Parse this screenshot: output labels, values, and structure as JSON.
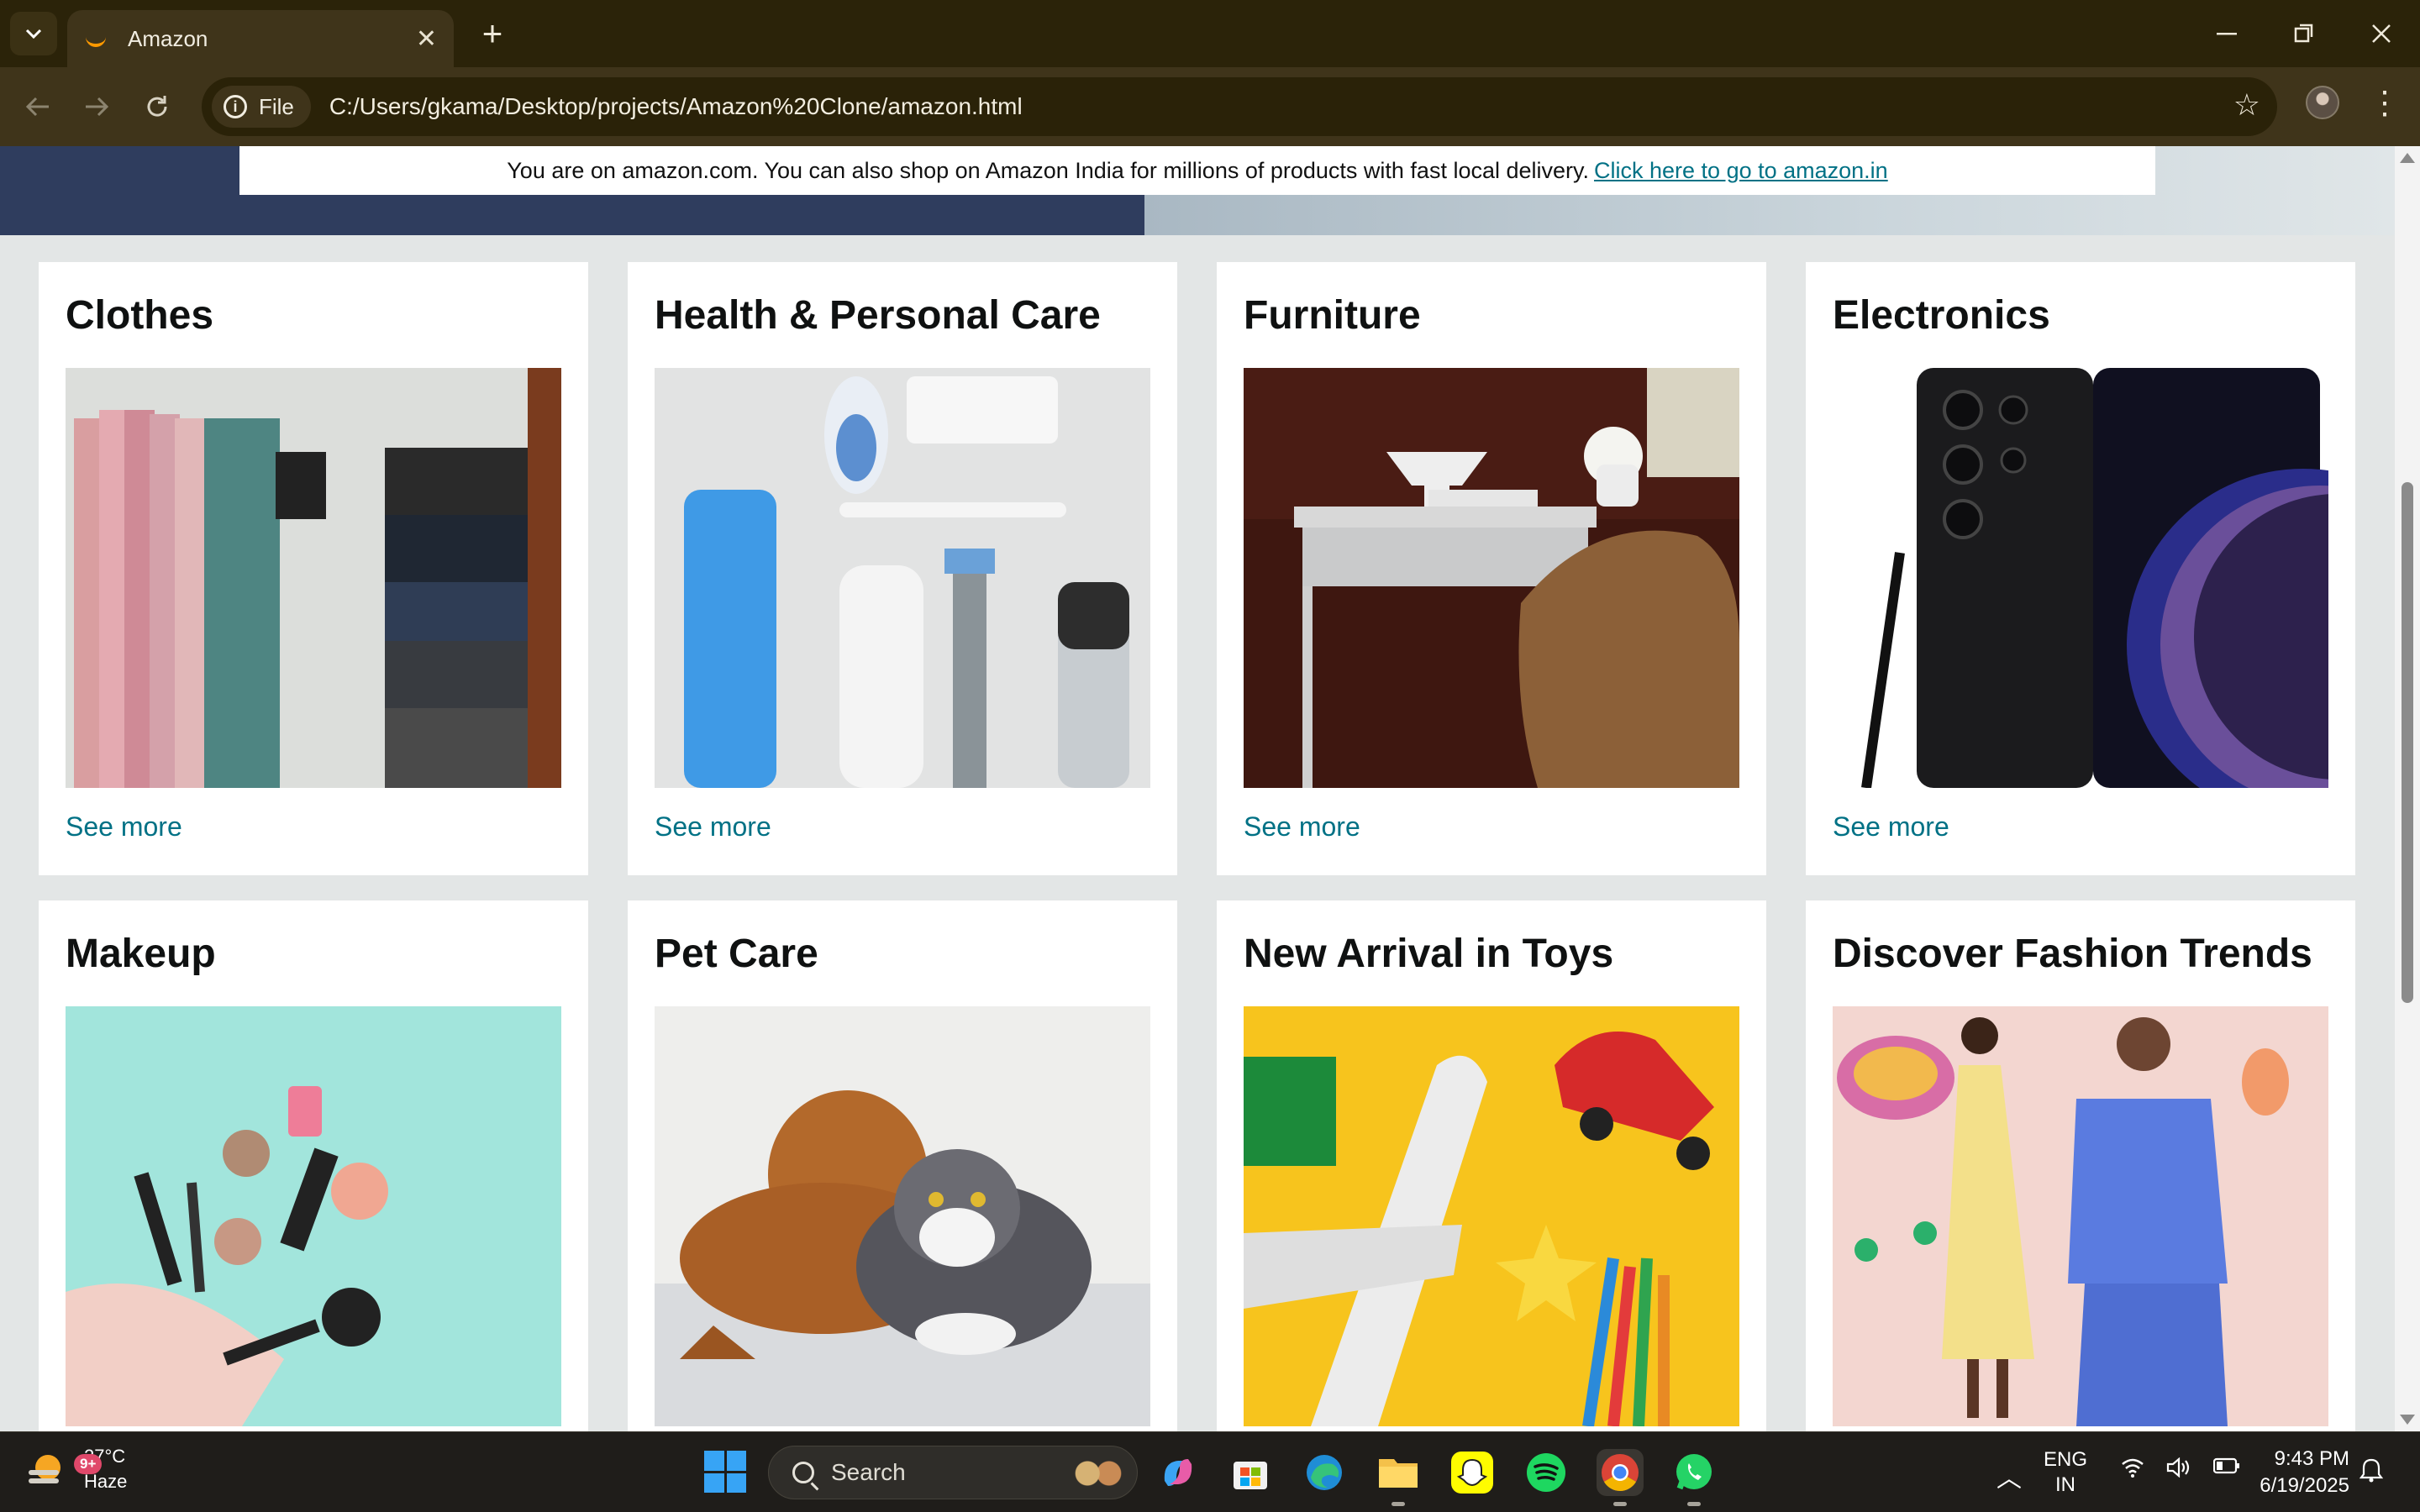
{
  "browser": {
    "tab_title": "Amazon",
    "tab_close": "✕",
    "new_tab": "+",
    "address_chip": "File",
    "address_url": "C:/Users/gkama/Desktop/projects/Amazon%20Clone/amazon.html"
  },
  "page": {
    "notice_text": "You are on amazon.com. You can also shop on Amazon India for millions of products with fast local delivery.",
    "notice_link": "Click here to go to amazon.in",
    "cards": [
      {
        "title": "Clothes",
        "link": "See more"
      },
      {
        "title": "Health & Personal Care",
        "link": "See more"
      },
      {
        "title": "Furniture",
        "link": "See more"
      },
      {
        "title": "Electronics",
        "link": "See more"
      },
      {
        "title": "Makeup",
        "link": ""
      },
      {
        "title": "Pet Care",
        "link": ""
      },
      {
        "title": "New Arrival in Toys",
        "link": ""
      },
      {
        "title": "Discover Fashion Trends",
        "link": ""
      }
    ],
    "colors": {
      "link": "#007185",
      "hero_dark": "#2f3d5e",
      "page_bg": "#e3e6e6"
    }
  },
  "taskbar": {
    "weather_badge": "9+",
    "weather_temp": "27°C",
    "weather_desc": "Haze",
    "search_placeholder": "Search",
    "lang_line1": "ENG",
    "lang_line2": "IN",
    "time": "9:43 PM",
    "date": "6/19/2025"
  }
}
